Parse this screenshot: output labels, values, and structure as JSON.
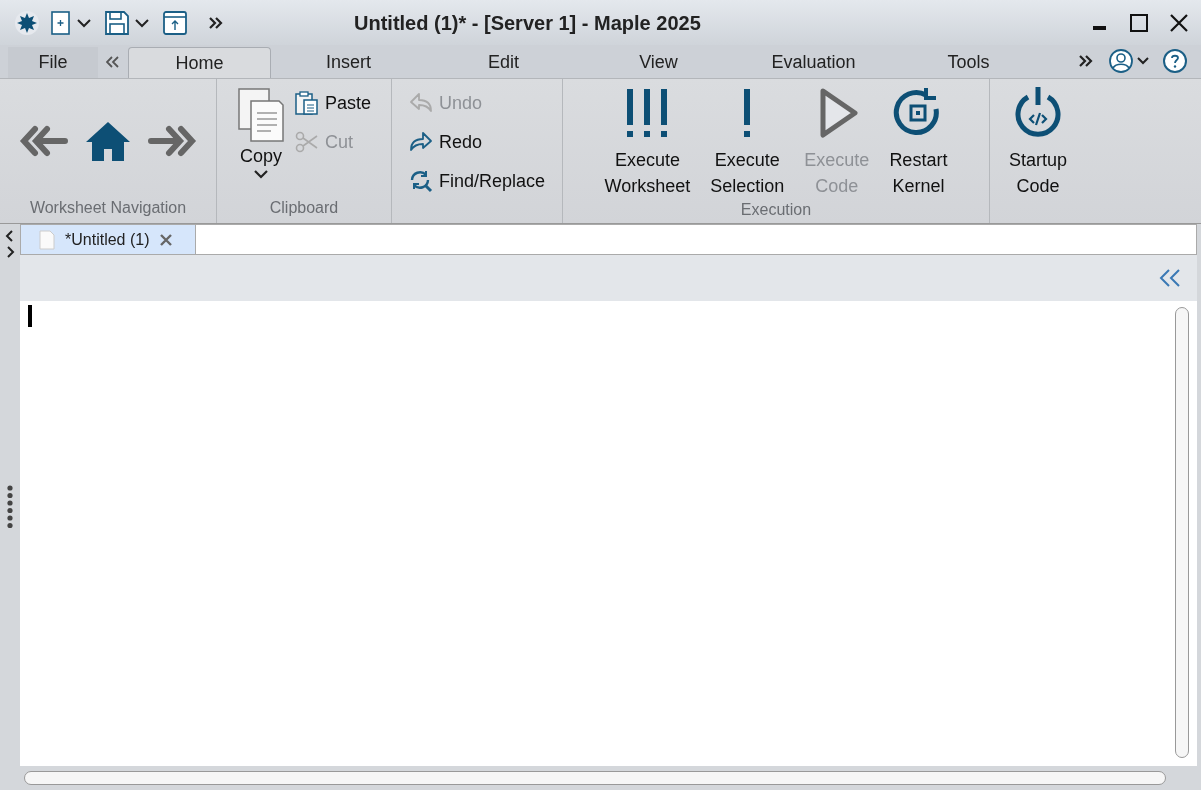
{
  "window": {
    "title": "Untitled (1)* - [Server 1] - Maple 2025"
  },
  "menu_tabs": [
    {
      "label": "File",
      "selected": false
    },
    {
      "label": "Home",
      "selected": true
    },
    {
      "label": "Insert",
      "selected": false
    },
    {
      "label": "Edit",
      "selected": false
    },
    {
      "label": "View",
      "selected": false
    },
    {
      "label": "Evaluation",
      "selected": false
    },
    {
      "label": "Tools",
      "selected": false
    }
  ],
  "ribbon_groups": [
    {
      "name": "Worksheet Navigation",
      "kind": "nav",
      "items": [
        {
          "disabled": false
        },
        {
          "disabled": false
        },
        {
          "disabled": false
        }
      ]
    },
    {
      "name": "Clipboard",
      "kind": "clipboard",
      "items": [
        {
          "label": "Copy",
          "disabled": false
        },
        {
          "label": "Paste",
          "disabled": false
        },
        {
          "label": "Cut",
          "disabled": true
        }
      ]
    },
    {
      "kind": "small",
      "items": [
        {
          "label": "Undo",
          "disabled": true
        },
        {
          "label": "Redo",
          "disabled": false
        },
        {
          "label": "Find/Replace",
          "disabled": false
        }
      ]
    },
    {
      "name": "Execution",
      "kind": "large",
      "items": [
        {
          "label": "Execute Worksheet",
          "disabled": false
        },
        {
          "label": "Execute Selection",
          "disabled": false
        },
        {
          "label": "Execute Code",
          "disabled": true
        },
        {
          "label": "Restart Kernel",
          "disabled": false
        }
      ]
    },
    {
      "kind": "large",
      "items": [
        {
          "label": "Startup Code",
          "disabled": false
        }
      ]
    }
  ],
  "document_tabs": [
    {
      "label": "*Untitled (1)",
      "selected": true
    }
  ]
}
